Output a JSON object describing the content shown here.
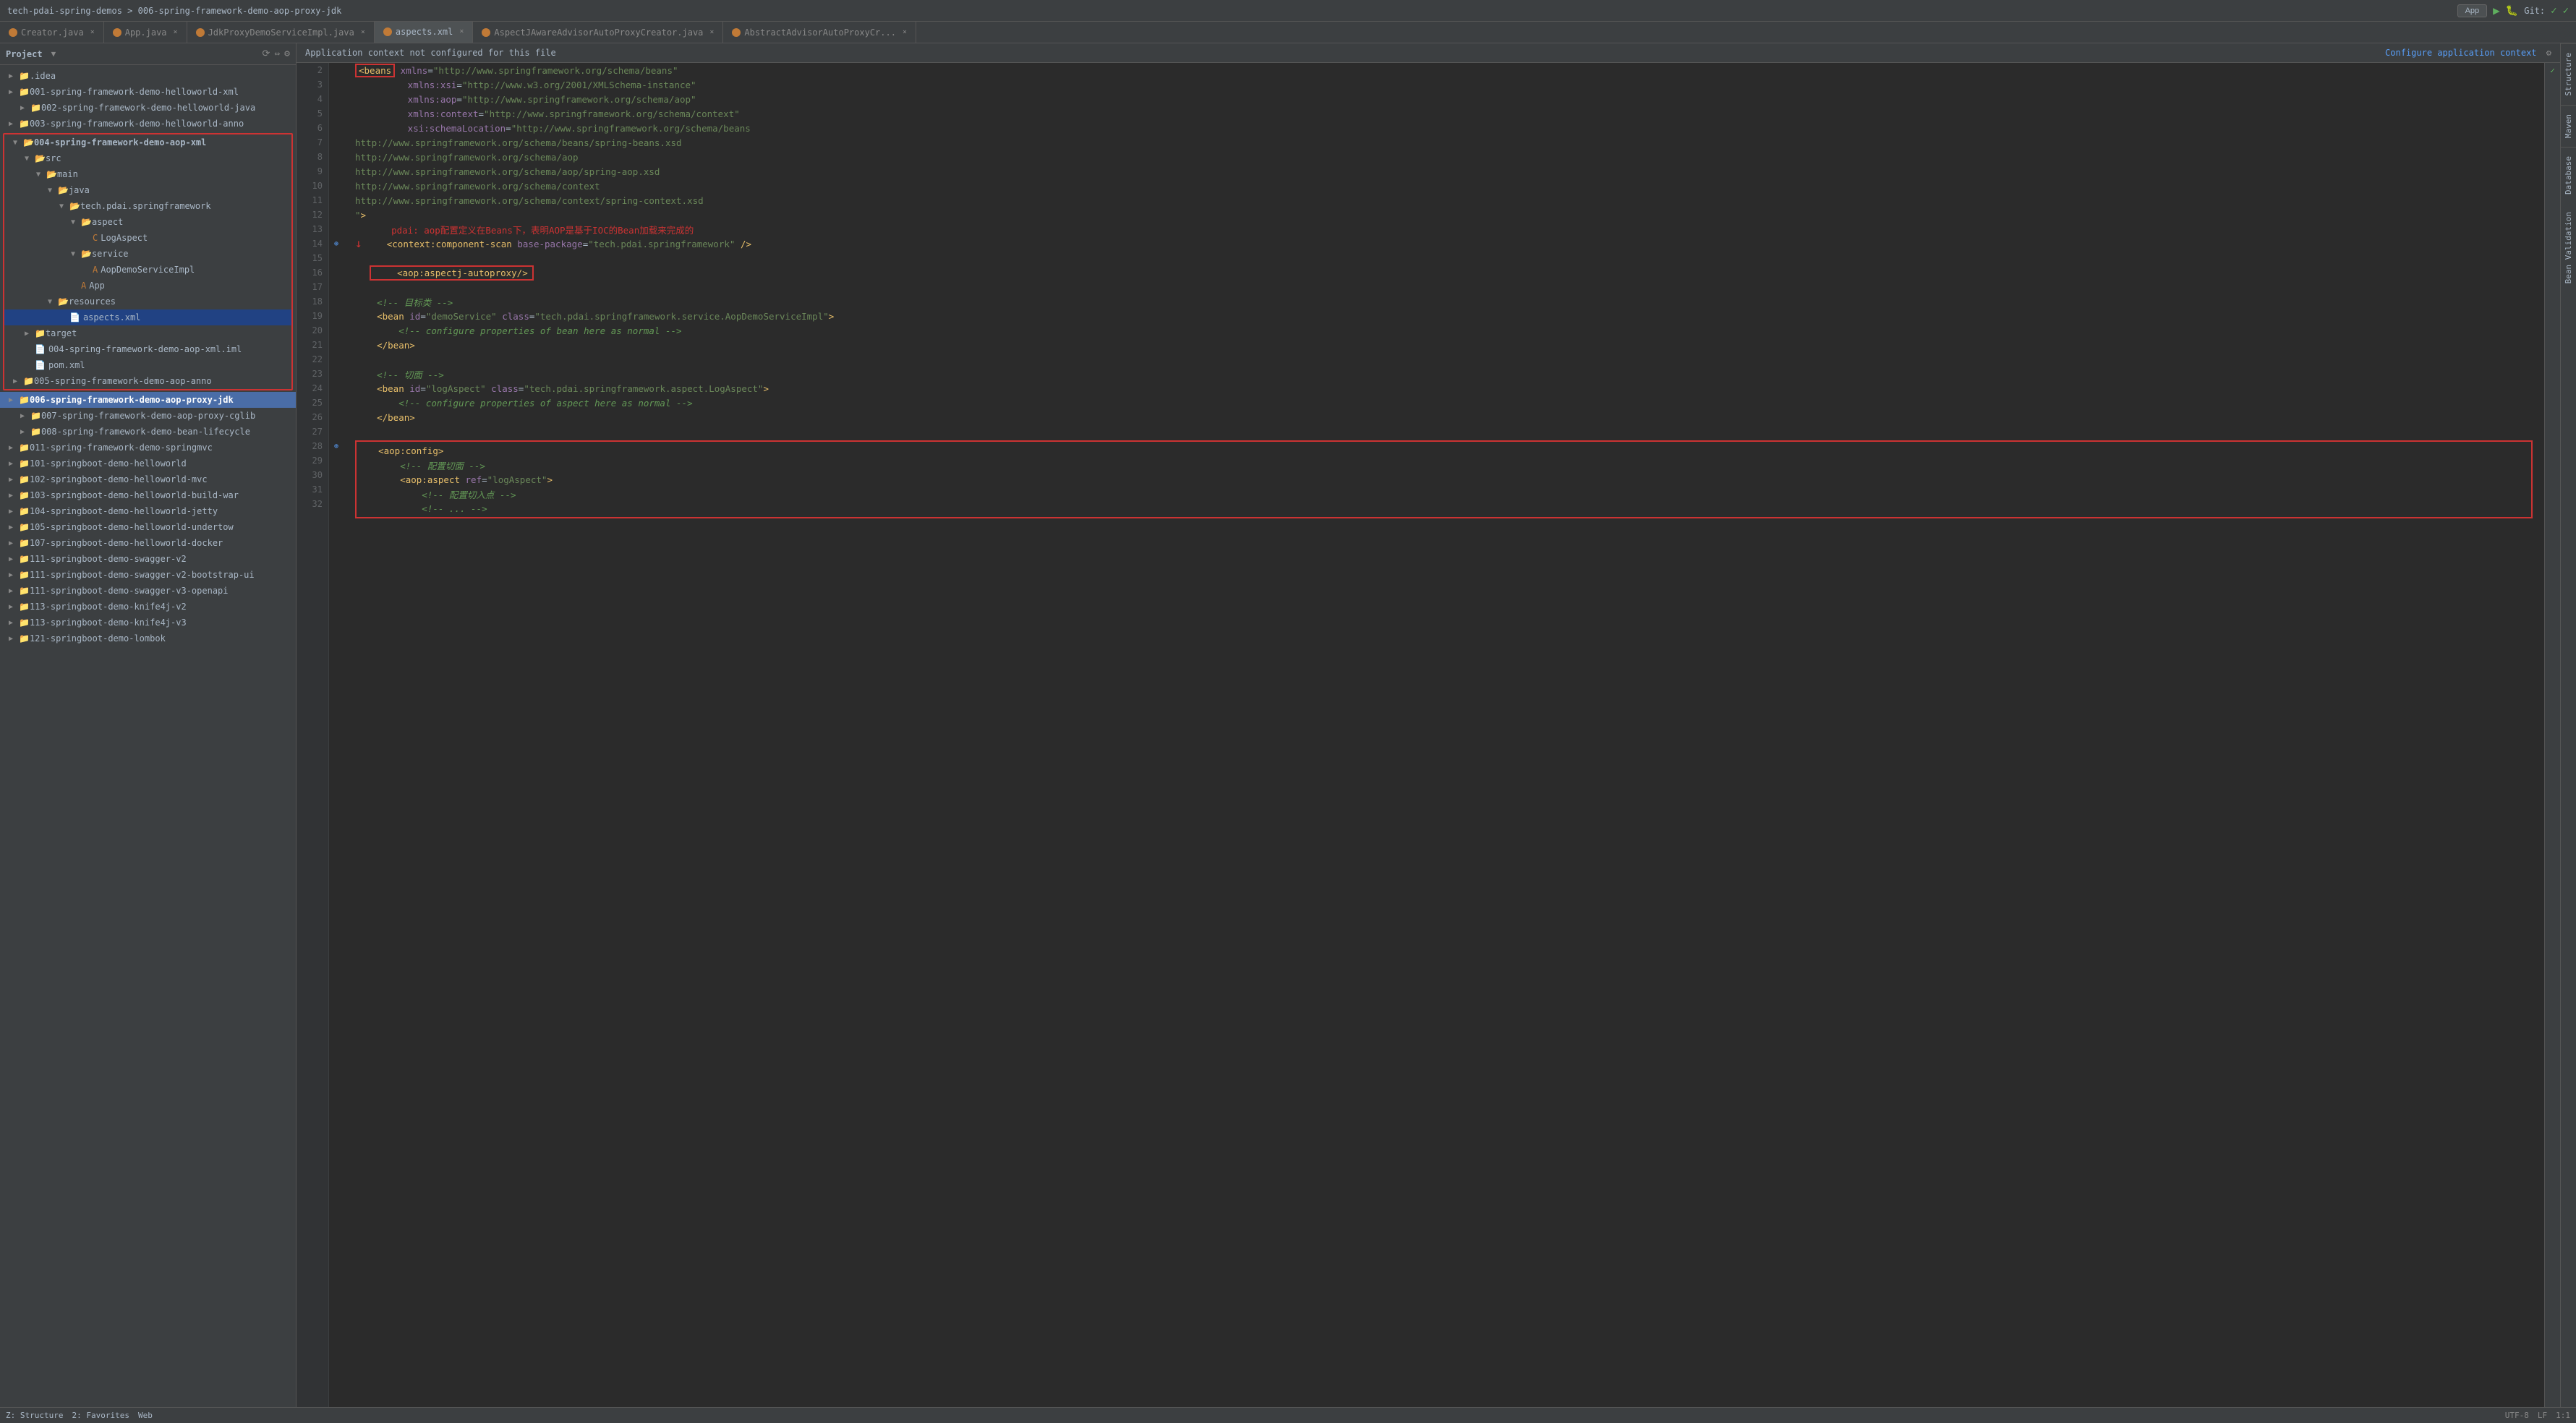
{
  "titlebar": {
    "breadcrumb": "tech-pdai-spring-demos > 006-spring-framework-demo-aop-proxy-jdk",
    "app_label": "App",
    "git_label": "Git:"
  },
  "tabs": [
    {
      "id": "creator",
      "label": "Creator.java",
      "type": "java",
      "active": false
    },
    {
      "id": "app",
      "label": "App.java",
      "type": "java",
      "active": false
    },
    {
      "id": "jdkproxy",
      "label": "JdkProxyDemoServiceImpl.java",
      "type": "java",
      "active": false
    },
    {
      "id": "aspects",
      "label": "aspects.xml",
      "type": "xml",
      "active": true
    },
    {
      "id": "aspectj",
      "label": "AspectJAwareAdvisorAutoProxyCreator.java",
      "type": "java",
      "active": false
    },
    {
      "id": "abstract",
      "label": "AbstractAdvisorAutoProxyCr...",
      "type": "java",
      "active": false
    }
  ],
  "sidebar": {
    "title": "Project",
    "items": [
      {
        "id": "idea",
        "label": ".idea",
        "indent": 0,
        "type": "folder",
        "arrow": "▶"
      },
      {
        "id": "001",
        "label": "001-spring-framework-demo-helloworld-xml",
        "indent": 0,
        "type": "folder",
        "arrow": "▶"
      },
      {
        "id": "002",
        "label": "002-spring-framework-demo-helloworld-java",
        "indent": 1,
        "type": "folder",
        "arrow": "▶"
      },
      {
        "id": "003",
        "label": "003-spring-framework-demo-helloworld-anno",
        "indent": 0,
        "type": "folder",
        "arrow": "▶"
      },
      {
        "id": "004",
        "label": "004-spring-framework-demo-aop-xml",
        "indent": 0,
        "type": "folder",
        "arrow": "▼",
        "expanded": true,
        "red_border": true
      },
      {
        "id": "src",
        "label": "src",
        "indent": 1,
        "type": "folder",
        "arrow": "▼"
      },
      {
        "id": "main",
        "label": "main",
        "indent": 2,
        "type": "folder",
        "arrow": "▼"
      },
      {
        "id": "java",
        "label": "java",
        "indent": 3,
        "type": "folder",
        "arrow": "▼"
      },
      {
        "id": "tech",
        "label": "tech.pdai.springframework",
        "indent": 4,
        "type": "folder",
        "arrow": "▼"
      },
      {
        "id": "aspect",
        "label": "aspect",
        "indent": 5,
        "type": "folder",
        "arrow": "▼"
      },
      {
        "id": "logaspect",
        "label": "LogAspect",
        "indent": 6,
        "type": "class",
        "arrow": ""
      },
      {
        "id": "service",
        "label": "service",
        "indent": 5,
        "type": "folder",
        "arrow": "▼"
      },
      {
        "id": "aopdemo",
        "label": "AopDemoServiceImpl",
        "indent": 6,
        "type": "class",
        "arrow": ""
      },
      {
        "id": "app",
        "label": "App",
        "indent": 5,
        "type": "class",
        "arrow": ""
      },
      {
        "id": "resources",
        "label": "resources",
        "indent": 3,
        "type": "folder",
        "arrow": "▼"
      },
      {
        "id": "aspectsxml",
        "label": "aspects.xml",
        "indent": 4,
        "type": "xml",
        "arrow": ""
      },
      {
        "id": "target",
        "label": "target",
        "indent": 1,
        "type": "folder",
        "arrow": "▶"
      },
      {
        "id": "iml",
        "label": "004-spring-framework-demo-aop-xml.iml",
        "indent": 1,
        "type": "file",
        "arrow": ""
      },
      {
        "id": "pom",
        "label": "pom.xml",
        "indent": 1,
        "type": "xml",
        "arrow": ""
      },
      {
        "id": "005",
        "label": "005-spring-framework-demo-aop-anno",
        "indent": 0,
        "type": "folder",
        "arrow": "▶"
      },
      {
        "id": "006",
        "label": "006-spring-framework-demo-aop-proxy-jdk",
        "indent": 0,
        "type": "folder",
        "arrow": "▶",
        "selected": true
      },
      {
        "id": "007",
        "label": "007-spring-framework-demo-aop-proxy-cglib",
        "indent": 1,
        "type": "folder",
        "arrow": "▶"
      },
      {
        "id": "008",
        "label": "008-spring-framework-demo-bean-lifecycle",
        "indent": 1,
        "type": "folder",
        "arrow": "▶"
      },
      {
        "id": "011",
        "label": "011-spring-framework-demo-springmvc",
        "indent": 0,
        "type": "folder",
        "arrow": "▶"
      },
      {
        "id": "101",
        "label": "101-springboot-demo-helloworld",
        "indent": 0,
        "type": "folder",
        "arrow": "▶"
      },
      {
        "id": "102",
        "label": "102-springboot-demo-helloworld-mvc",
        "indent": 0,
        "type": "folder",
        "arrow": "▶"
      },
      {
        "id": "103",
        "label": "103-springboot-demo-helloworld-build-war",
        "indent": 0,
        "type": "folder",
        "arrow": "▶"
      },
      {
        "id": "104",
        "label": "104-springboot-demo-helloworld-jetty",
        "indent": 0,
        "type": "folder",
        "arrow": "▶"
      },
      {
        "id": "105",
        "label": "105-springboot-demo-helloworld-undertow",
        "indent": 0,
        "type": "folder",
        "arrow": "▶"
      },
      {
        "id": "107",
        "label": "107-springboot-demo-helloworld-docker",
        "indent": 0,
        "type": "folder",
        "arrow": "▶"
      },
      {
        "id": "111a",
        "label": "111-springboot-demo-swagger-v2",
        "indent": 0,
        "type": "folder",
        "arrow": "▶"
      },
      {
        "id": "111b",
        "label": "111-springboot-demo-swagger-v2-bootstrap-ui",
        "indent": 0,
        "type": "folder",
        "arrow": "▶"
      },
      {
        "id": "111c",
        "label": "111-springboot-demo-swagger-v3-openapi",
        "indent": 0,
        "type": "folder",
        "arrow": "▶"
      },
      {
        "id": "113a",
        "label": "113-springboot-demo-knife4j-v2",
        "indent": 0,
        "type": "folder",
        "arrow": "▶"
      },
      {
        "id": "113b",
        "label": "113-springboot-demo-knife4j-v3",
        "indent": 0,
        "type": "folder",
        "arrow": "▶"
      },
      {
        "id": "121",
        "label": "121-springboot-demo-lombok",
        "indent": 0,
        "type": "folder",
        "arrow": "▶"
      }
    ]
  },
  "notification": {
    "text": "Application context not configured for this file",
    "configure_label": "Configure application context",
    "gear": "⚙"
  },
  "code": {
    "lines": [
      {
        "num": 2,
        "content": "<beans xmlns=\"http://www.springframework.org/schema/beans\"",
        "type": "tag",
        "red_box_start": true
      },
      {
        "num": 3,
        "content": "       xmlns:xsi=\"http://www.w3.org/2001/XMLSchema-instance\"",
        "type": "attr"
      },
      {
        "num": 4,
        "content": "       xmlns:aop=\"http://www.springframework.org/schema/aop\"",
        "type": "attr"
      },
      {
        "num": 5,
        "content": "       xmlns:context=\"http://www.springframework.org/schema/context\"",
        "type": "attr"
      },
      {
        "num": 6,
        "content": "       xsi:schemaLocation=\"http://www.springframework.org/schema/beans",
        "type": "attr"
      },
      {
        "num": 7,
        "content": "http://www.springframework.org/schema/beans/spring-beans.xsd",
        "type": "url"
      },
      {
        "num": 8,
        "content": "http://www.springframework.org/schema/aop",
        "type": "url"
      },
      {
        "num": 9,
        "content": "http://www.springframework.org/schema/aop/spring-aop.xsd",
        "type": "url"
      },
      {
        "num": 10,
        "content": "http://www.springframework.org/schema/context",
        "type": "url"
      },
      {
        "num": 11,
        "content": "http://www.springframework.org/schema/context/spring-context.xsd",
        "type": "url"
      },
      {
        "num": 12,
        "content": "\">",
        "type": "tag"
      },
      {
        "num": 13,
        "content": "    pdai: aop配置定义在Beans下，表明AOP是基于IOC的Bean加载来完成的",
        "type": "chinese_comment"
      },
      {
        "num": 14,
        "content": "    <context:component-scan base-package=\"tech.pdai.springframework\" />",
        "type": "tag_line",
        "has_marker": true
      },
      {
        "num": 15,
        "content": "",
        "type": "empty"
      },
      {
        "num": 16,
        "content": "    <aop:aspectj-autoproxy/>",
        "type": "tag_line_red_box"
      },
      {
        "num": 17,
        "content": "",
        "type": "empty"
      },
      {
        "num": 18,
        "content": "    <!-- 目标类 -->",
        "type": "comment"
      },
      {
        "num": 19,
        "content": "    <bean id=\"demoService\" class=\"tech.pdai.springframework.service.AopDemoServiceImpl\">",
        "type": "tag"
      },
      {
        "num": 20,
        "content": "        <!-- configure properties of bean here as normal -->",
        "type": "comment"
      },
      {
        "num": 21,
        "content": "    </bean>",
        "type": "tag"
      },
      {
        "num": 22,
        "content": "",
        "type": "empty"
      },
      {
        "num": 23,
        "content": "    <!-- 切面 -->",
        "type": "comment"
      },
      {
        "num": 24,
        "content": "    <bean id=\"logAspect\" class=\"tech.pdai.springframework.aspect.LogAspect\">",
        "type": "tag"
      },
      {
        "num": 25,
        "content": "        <!-- configure properties of aspect here as normal -->",
        "type": "comment"
      },
      {
        "num": 26,
        "content": "    </bean>",
        "type": "tag"
      },
      {
        "num": 27,
        "content": "",
        "type": "empty"
      },
      {
        "num": 28,
        "content": "    <aop:config>",
        "type": "tag_aop_config"
      },
      {
        "num": 29,
        "content": "        <!-- 配置切面 -->",
        "type": "comment"
      },
      {
        "num": 30,
        "content": "        <aop:aspect ref=\"logAspect\">",
        "type": "tag"
      },
      {
        "num": 31,
        "content": "            <!-- 配置切入点 -->",
        "type": "comment"
      },
      {
        "num": 32,
        "content": "            <!-- ... -->",
        "type": "comment"
      }
    ]
  },
  "right_panels": [
    "Structure",
    "Maven",
    "Database",
    "Bean Validation"
  ],
  "bottom_tabs": [
    "Z: Structure",
    "2: Favorites",
    "Web"
  ],
  "checkmark": "✓"
}
